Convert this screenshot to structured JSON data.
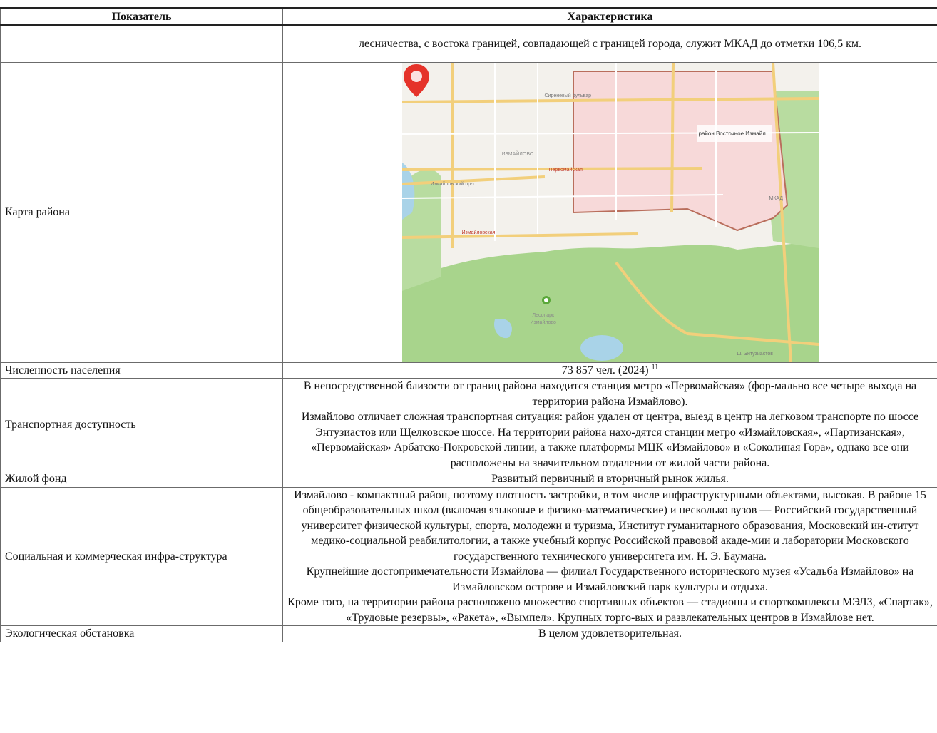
{
  "header": {
    "col1": "Показатель",
    "col2": "Характеристика"
  },
  "rows": [
    {
      "label": "",
      "value": "лесничества, с востока границей, совпадающей с границей города, служит МКАД до отметки 106,5 км."
    },
    {
      "label": "Карта района",
      "map": {
        "district_label": "район Восточное Измайл...",
        "metro_pervomayskaya": "Первомайская",
        "metro_izmaylovskaya": "Измайловская",
        "area_izmaylovo": "ИЗМАЙЛОВО",
        "street_top": "Сиреневый бульвар",
        "street_left": "Измайловский пр-т",
        "street_bottom": "ш. Энтузиастов",
        "street_right": "МКАД",
        "forest_line1": "Лесопарк",
        "forest_line2": "Измайлово",
        "colors": {
          "forest": "#a8d48c",
          "water": "#a9d3e8",
          "road": "#f2cf7b",
          "district_fill": "#f7d9d9",
          "district_border": "#b96e5c",
          "pin": "#e5332a"
        }
      }
    },
    {
      "label": "Численность населения",
      "value": "73 857 чел. (2024)",
      "footnote": "11"
    },
    {
      "label": "Транспортная доступность",
      "paragraphs": [
        "В непосредственной близости от границ района находится станция метро «Первомайская» (фор-мально все четыре выхода на территории района Измайлово).",
        "Измайлово отличает сложная транспортная ситуация: район удален от центра, выезд в центр на легковом транспорте по шоссе Энтузиастов или Щелковское шоссе. На территории района нахо-дятся станции метро «Измайловская», «Партизанская», «Первомайская» Арбатско-Покровской линии, а также платформы МЦК «Измайлово» и «Соколиная Гора», однако все они расположены на значительном отдалении от жилой части района."
      ]
    },
    {
      "label": "Жилой фонд",
      "value": "Развитый первичный и вторичный рынок жилья."
    },
    {
      "label": "Социальная и коммерческая инфра-структура",
      "paragraphs": [
        "Измайлово - компактный район, поэтому плотность застройки, в том числе инфраструктурными объектами, высокая. В районе 15 общеобразовательных школ (включая языковые и физико-математические) и несколько вузов — Российский государственный университет физической культуры, спорта, молодежи и туризма, Институт гуманитарного образования, Московский ин-ститут медико-социальной реабилитологии, а также учебный корпус Российской правовой акаде-мии и лаборатории Московского государственного технического университета им. Н. Э. Баумана.",
        "Крупнейшие достопримечательности Измайлова — филиал Государственного исторического музея «Усадьба Измайлово» на Измайловском острове и Измайловский парк культуры и отдыха.",
        "Кроме того, на территории района расположено множество спортивных объектов — стадионы и спорткомплексы МЭЛЗ, «Спартак», «Трудовые резервы», «Ракета», «Вымпел». Крупных торго-вых и развлекательных центров в Измайлове нет."
      ]
    },
    {
      "label": "Экологическая обстановка",
      "value": "В целом удовлетворительная."
    }
  ]
}
